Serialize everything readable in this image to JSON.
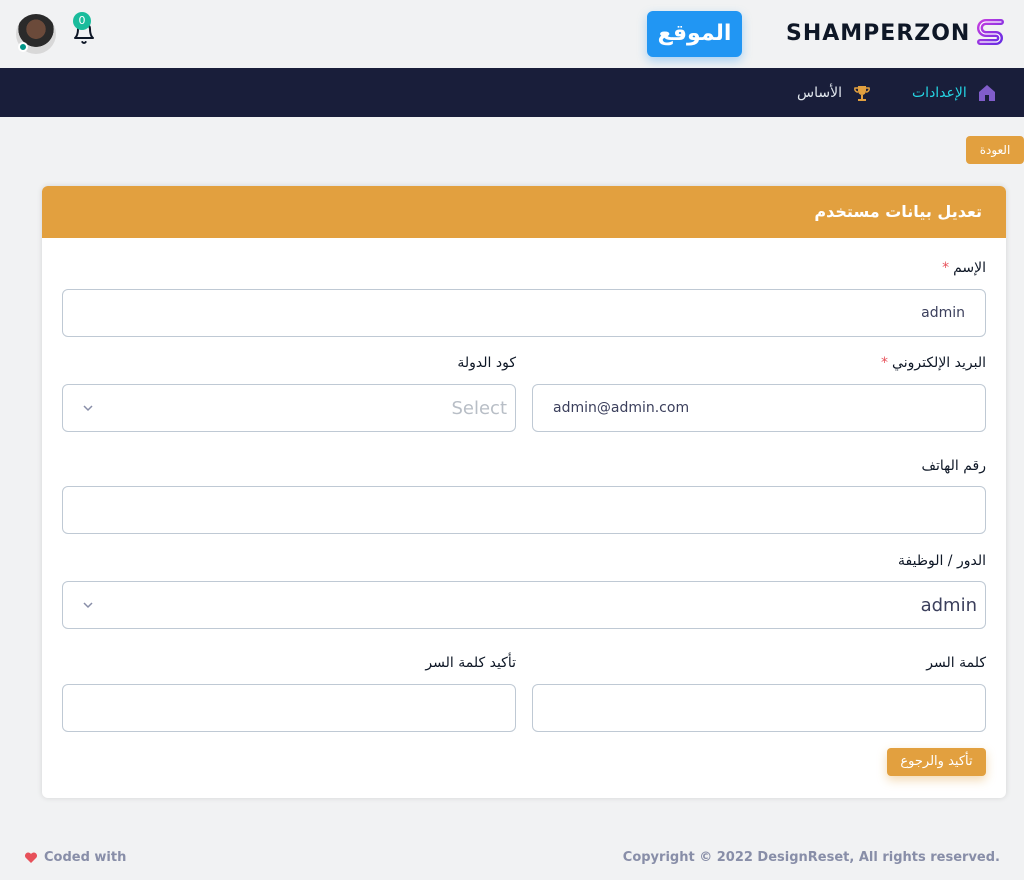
{
  "header": {
    "notification_count": "0",
    "site_button_label": "الموقع",
    "brand_name": "SHAMPERZON",
    "brand_color": "#8e2de2"
  },
  "nav": {
    "items": [
      {
        "label": "الإعدادات",
        "icon": "home-icon",
        "active": true
      },
      {
        "label": "الأساس",
        "icon": "trophy-icon",
        "active": false
      }
    ]
  },
  "back_label": "العودة",
  "form": {
    "title": "تعديل بيانات مستخدم",
    "name": {
      "label": "الإسم",
      "value": "admin",
      "required": true
    },
    "email": {
      "label": "البريد الإلكتروني",
      "value": "admin@admin.com",
      "required": true
    },
    "country_code": {
      "label": "كود الدولة",
      "value": "Select"
    },
    "phone": {
      "label": "رقم الهاتف",
      "value": ""
    },
    "role": {
      "label": "الدور / الوظيفة",
      "value": "admin"
    },
    "password": {
      "label": "كلمة السر",
      "value": ""
    },
    "password_confirm": {
      "label": "تأكيد كلمة السر",
      "value": ""
    },
    "submit_label": "تأكيد والرجوع",
    "required_mark": "*"
  },
  "footer": {
    "copyright": "Copyright © 2022 DesignReset, All rights reserved.",
    "coded_with": "Coded with"
  },
  "colors": {
    "accent_orange": "#e2a03f",
    "nav_bg": "#191e3a",
    "primary_blue": "#2196f3",
    "active_nav": "#25d5e4"
  }
}
